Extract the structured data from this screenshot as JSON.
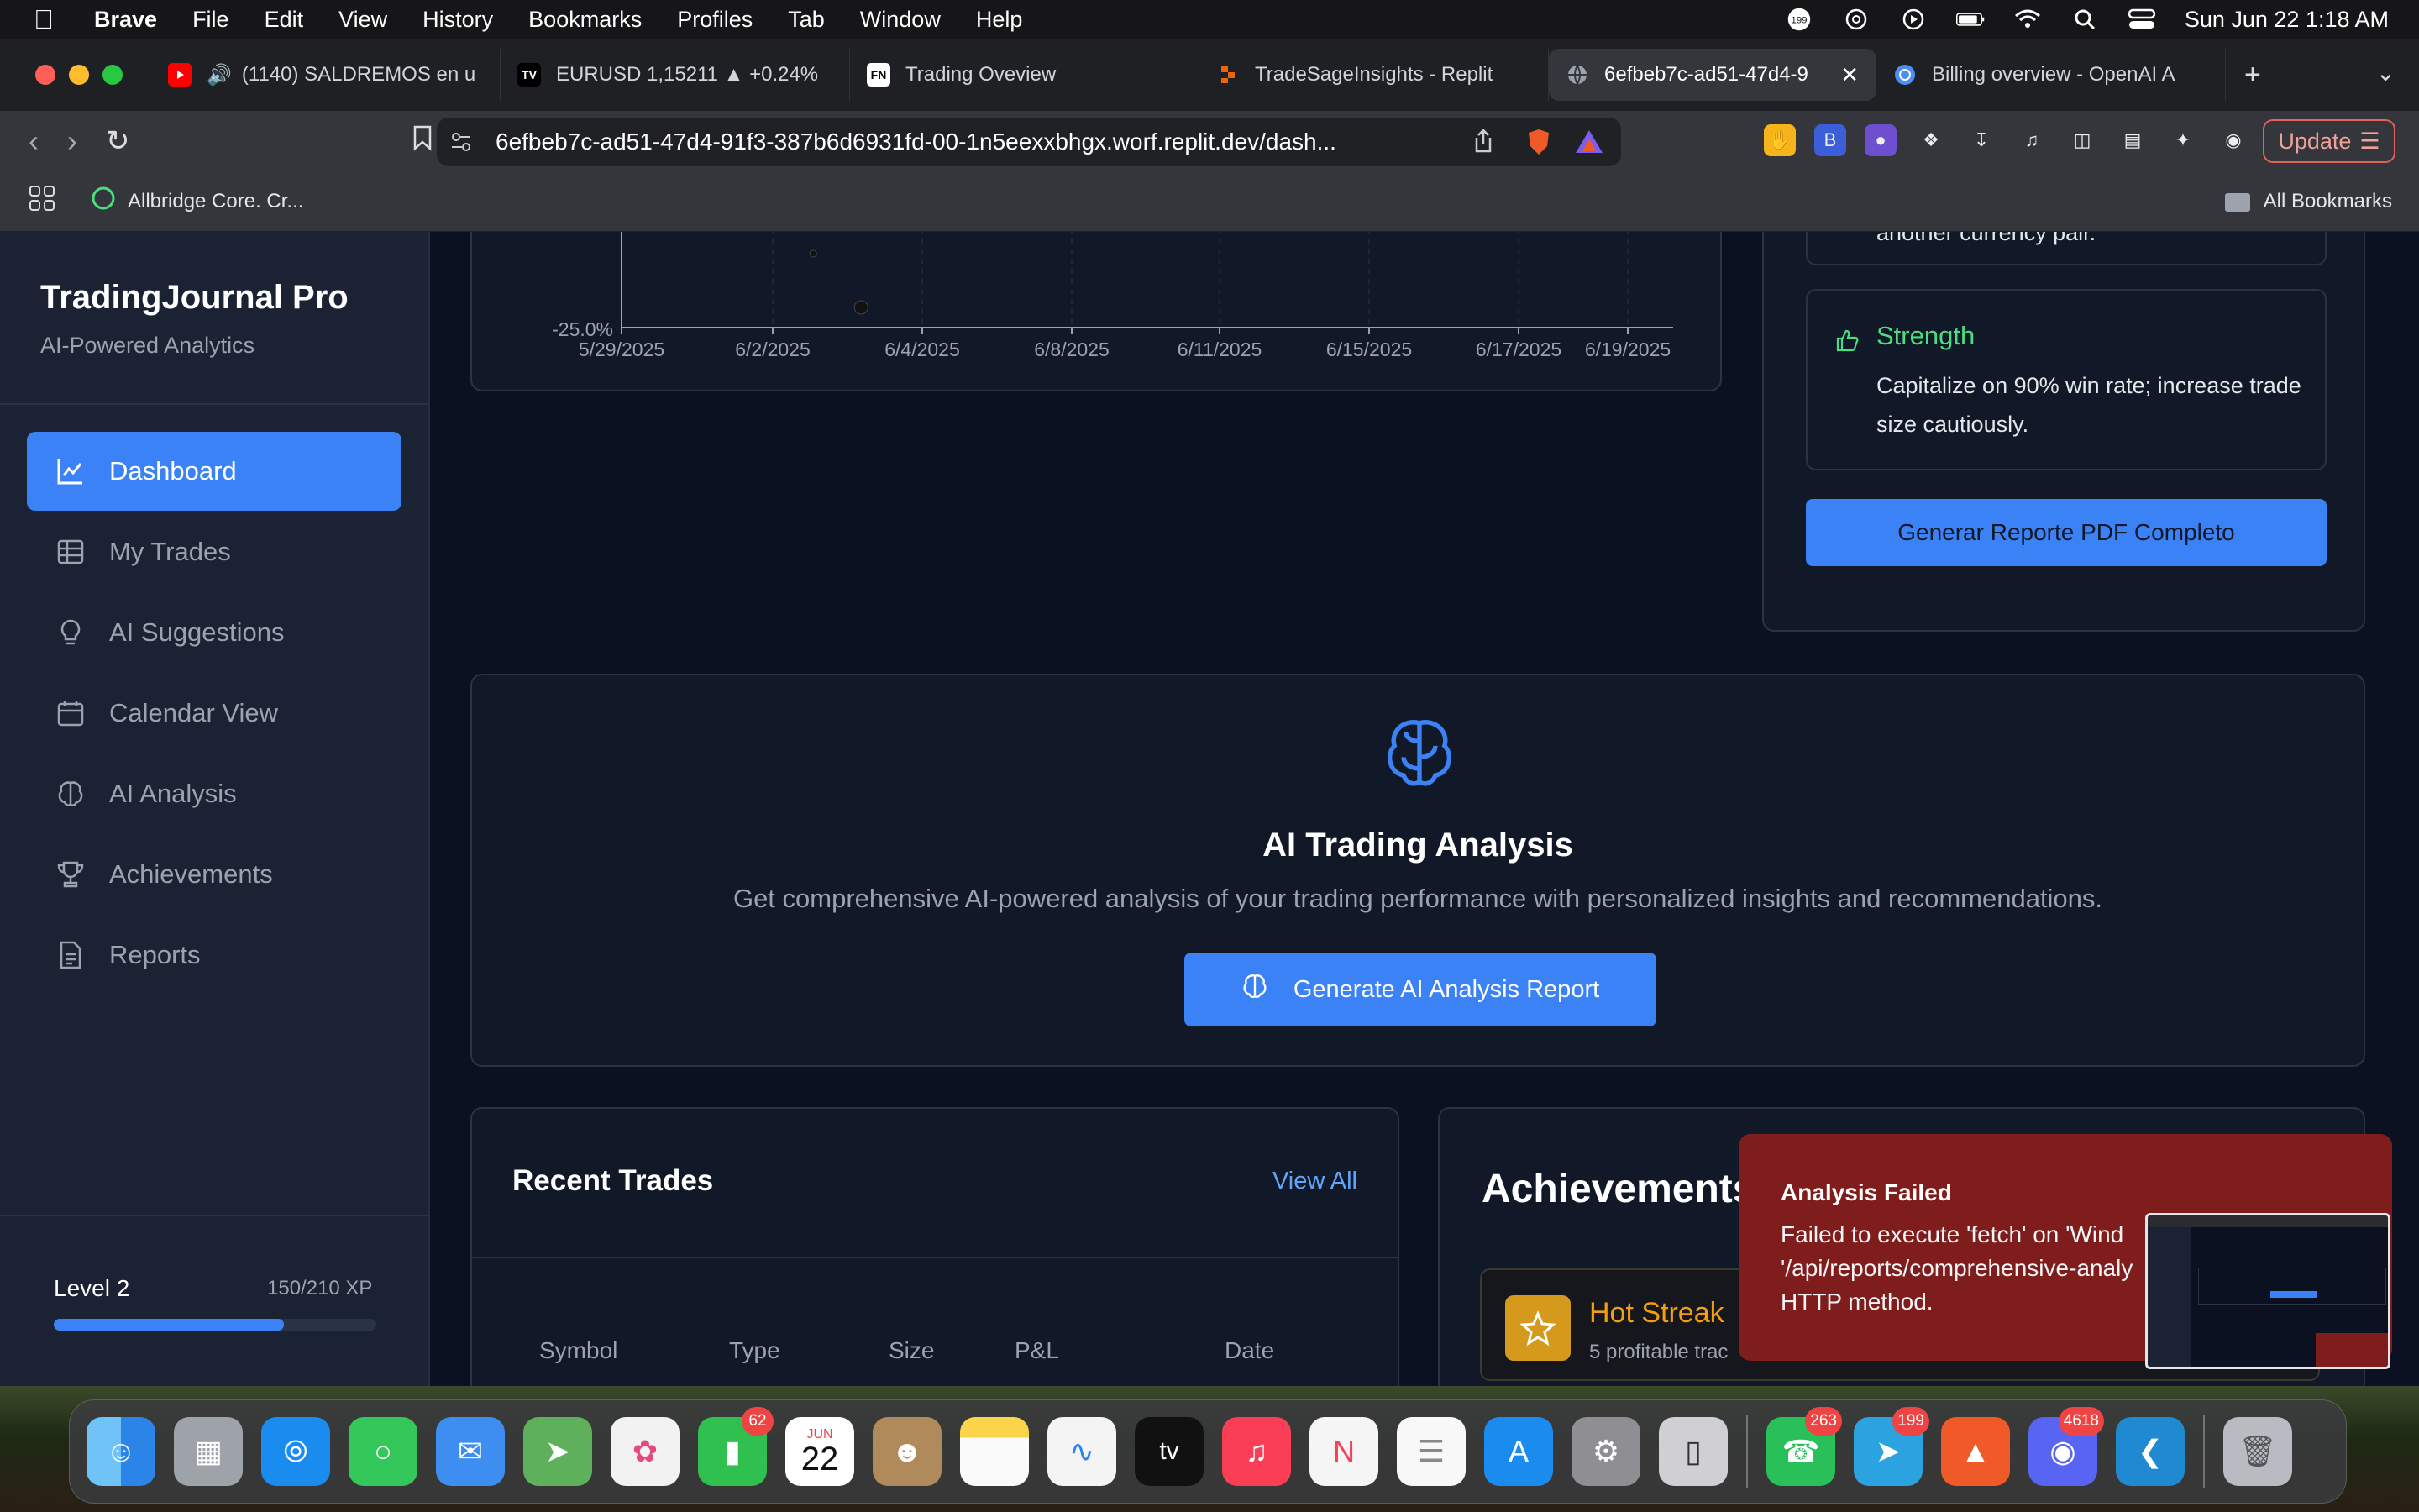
{
  "menubar": {
    "app_name": "Brave",
    "items": [
      "File",
      "Edit",
      "View",
      "History",
      "Bookmarks",
      "Profiles",
      "Tab",
      "Window",
      "Help"
    ],
    "notification_count": "199",
    "clock": "Sun Jun 22  1:18 AM"
  },
  "tabs": [
    {
      "title": "(1140) SALDREMOS en u",
      "icon": "youtube-icon"
    },
    {
      "title": "EURUSD 1,15211 ▲ +0.24%",
      "icon": "tradingview-icon"
    },
    {
      "title": "Trading Oveview",
      "icon": "fn-icon"
    },
    {
      "title": "TradeSageInsights - Replit",
      "icon": "replit-icon"
    },
    {
      "title": "6efbeb7c-ad51-47d4-9",
      "icon": "globe-icon"
    },
    {
      "title": "Billing overview - OpenAI A",
      "icon": "openai-icon"
    }
  ],
  "tab_labels": {
    "fn": "FN"
  },
  "toolbar": {
    "url": "6efbeb7c-ad51-47d4-91f3-387b6d6931fd-00-1n5eexxbhgx.worf.replit.dev/dash...",
    "update_label": "Update"
  },
  "bookmarks": {
    "first": "Allbridge Core. Cr...",
    "all": "All Bookmarks"
  },
  "sidebar": {
    "brand": "TradingJournal Pro",
    "subtitle": "AI-Powered Analytics",
    "nav": [
      {
        "label": "Dashboard",
        "icon": "chart-line-icon"
      },
      {
        "label": "My Trades",
        "icon": "table-icon"
      },
      {
        "label": "AI Suggestions",
        "icon": "lightbulb-icon"
      },
      {
        "label": "Calendar View",
        "icon": "calendar-icon"
      },
      {
        "label": "AI Analysis",
        "icon": "brain-icon"
      },
      {
        "label": "Achievements",
        "icon": "trophy-icon"
      },
      {
        "label": "Reports",
        "icon": "file-icon"
      }
    ],
    "level": "Level 2",
    "xp": "150/210 XP",
    "xp_progress": 0.714
  },
  "chart_data": {
    "type": "scatter",
    "x_ticks": [
      "5/29/2025",
      "6/2/2025",
      "6/4/2025",
      "6/8/2025",
      "6/11/2025",
      "6/15/2025",
      "6/17/2025",
      "6/19/2025"
    ],
    "y_tick_visible": "-25.0%",
    "points": [
      {
        "x": "6/2/2025",
        "y": -17
      },
      {
        "x": "6/3/2025",
        "y": -25
      }
    ]
  },
  "insights": {
    "partial_text": "another currency pair.",
    "strength_title": "Strength",
    "strength_text": "Capitalize on 90% win rate; increase trade size cautiously.",
    "pdf_button": "Generar Reporte PDF Completo"
  },
  "ai": {
    "title": "AI Trading Analysis",
    "description": "Get comprehensive AI-powered analysis of your trading performance with personalized insights and recommendations.",
    "button": "Generate AI Analysis Report"
  },
  "recent_trades": {
    "title": "Recent Trades",
    "view_all": "View All",
    "columns": [
      "Symbol",
      "Type",
      "Size",
      "P&L",
      "Date"
    ]
  },
  "achievements": {
    "title": "Achievements",
    "item_title": "Hot Streak",
    "item_desc": "5 profitable trac"
  },
  "toast": {
    "title": "Analysis Failed",
    "message": "Failed to execute 'fetch' on 'Wind\n'/api/reports/comprehensive-analy\nHTTP method."
  },
  "dock": {
    "apps": [
      {
        "name": "finder-icon",
        "color": "#2b84e8"
      },
      {
        "name": "launchpad-icon",
        "color": "#9ea3aa"
      },
      {
        "name": "safari-icon",
        "color": "#1a8cf0"
      },
      {
        "name": "messages-icon",
        "color": "#34c759"
      },
      {
        "name": "mail-icon",
        "color": "#3d8ef0"
      },
      {
        "name": "maps-icon",
        "color": "#5fb05a"
      },
      {
        "name": "photos-icon",
        "color": "#f2f2f2"
      },
      {
        "name": "facetime-icon",
        "color": "#30c050",
        "badge": "62"
      },
      {
        "name": "calendar-icon",
        "color": "#ffffff"
      },
      {
        "name": "contacts-icon",
        "color": "#b08a5a"
      },
      {
        "name": "notes-icon",
        "color": "#fbd44a"
      },
      {
        "name": "freeform-icon",
        "color": "#f4f4f4"
      },
      {
        "name": "tv-icon",
        "color": "#111111"
      },
      {
        "name": "music-icon",
        "color": "#fa3e55"
      },
      {
        "name": "news-icon",
        "color": "#f5f5f5"
      },
      {
        "name": "reminders-icon",
        "color": "#f8f8f8"
      },
      {
        "name": "appstore-icon",
        "color": "#1a8cf0"
      },
      {
        "name": "settings-icon",
        "color": "#8e8e93"
      },
      {
        "name": "iphone-mirroring-icon",
        "color": "#d0d0d4"
      },
      {
        "name": "whatsapp-icon",
        "color": "#29c05a",
        "badge": "263"
      },
      {
        "name": "telegram-icon",
        "color": "#2aa3e0",
        "badge": "199"
      },
      {
        "name": "brave-icon",
        "color": "#f05a28"
      },
      {
        "name": "discord-icon",
        "color": "#5865f2",
        "badge": "4618"
      },
      {
        "name": "vscode-icon",
        "color": "#1f8ad2"
      },
      {
        "name": "trash-icon",
        "color": "#b8bcc2"
      }
    ],
    "calendar_month": "JUN",
    "calendar_day": "22",
    "tv_label": "tv"
  },
  "colors": {
    "accent": "#3b82f6",
    "strength": "#4ade80",
    "toast_bg": "#7f1d1d",
    "achievement_gold": "#f59e0b"
  }
}
